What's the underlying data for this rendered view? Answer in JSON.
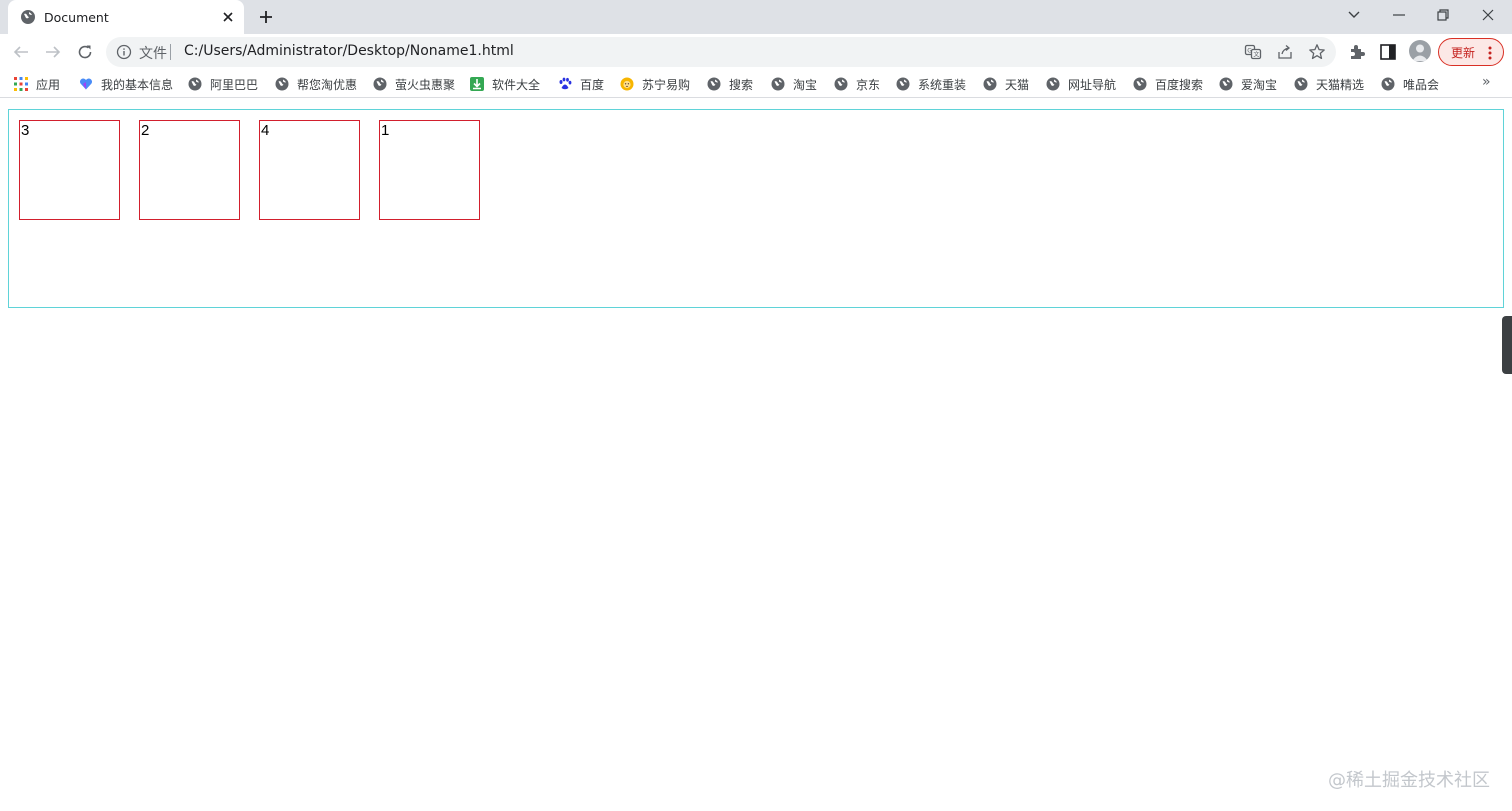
{
  "tab": {
    "title": "Document"
  },
  "toolbar": {
    "scheme_label": "文件",
    "url": "C:/Users/Administrator/Desktop/Noname1.html",
    "update_label": "更新"
  },
  "bookmarks": [
    {
      "label": "应用",
      "icon": "apps-grid-icon"
    },
    {
      "label": "我的基本信息",
      "icon": "heart-icon"
    },
    {
      "label": "阿里巴巴",
      "icon": "globe-icon"
    },
    {
      "label": "帮您淘优惠",
      "icon": "globe-icon"
    },
    {
      "label": "萤火虫惠聚",
      "icon": "globe-icon"
    },
    {
      "label": "软件大全",
      "icon": "download-icon"
    },
    {
      "label": "百度",
      "icon": "paw-icon"
    },
    {
      "label": "苏宁易购",
      "icon": "lion-icon"
    },
    {
      "label": "搜索",
      "icon": "globe-icon"
    },
    {
      "label": "淘宝",
      "icon": "globe-icon"
    },
    {
      "label": "京东",
      "icon": "globe-icon"
    },
    {
      "label": "系统重装",
      "icon": "globe-icon"
    },
    {
      "label": "天猫",
      "icon": "globe-icon"
    },
    {
      "label": "网址导航",
      "icon": "globe-icon"
    },
    {
      "label": "百度搜索",
      "icon": "globe-icon"
    },
    {
      "label": "爱淘宝",
      "icon": "globe-icon"
    },
    {
      "label": "天猫精选",
      "icon": "globe-icon"
    },
    {
      "label": "唯品会",
      "icon": "globe-icon"
    }
  ],
  "bookmarks_more": "»",
  "boxes": [
    "3",
    "2",
    "4",
    "1"
  ],
  "watermark": "@稀土掘金技术社区",
  "colors": {
    "container_border": "#5fd3d8",
    "box_border": "#d21f2d",
    "update_accent": "#d93025"
  }
}
